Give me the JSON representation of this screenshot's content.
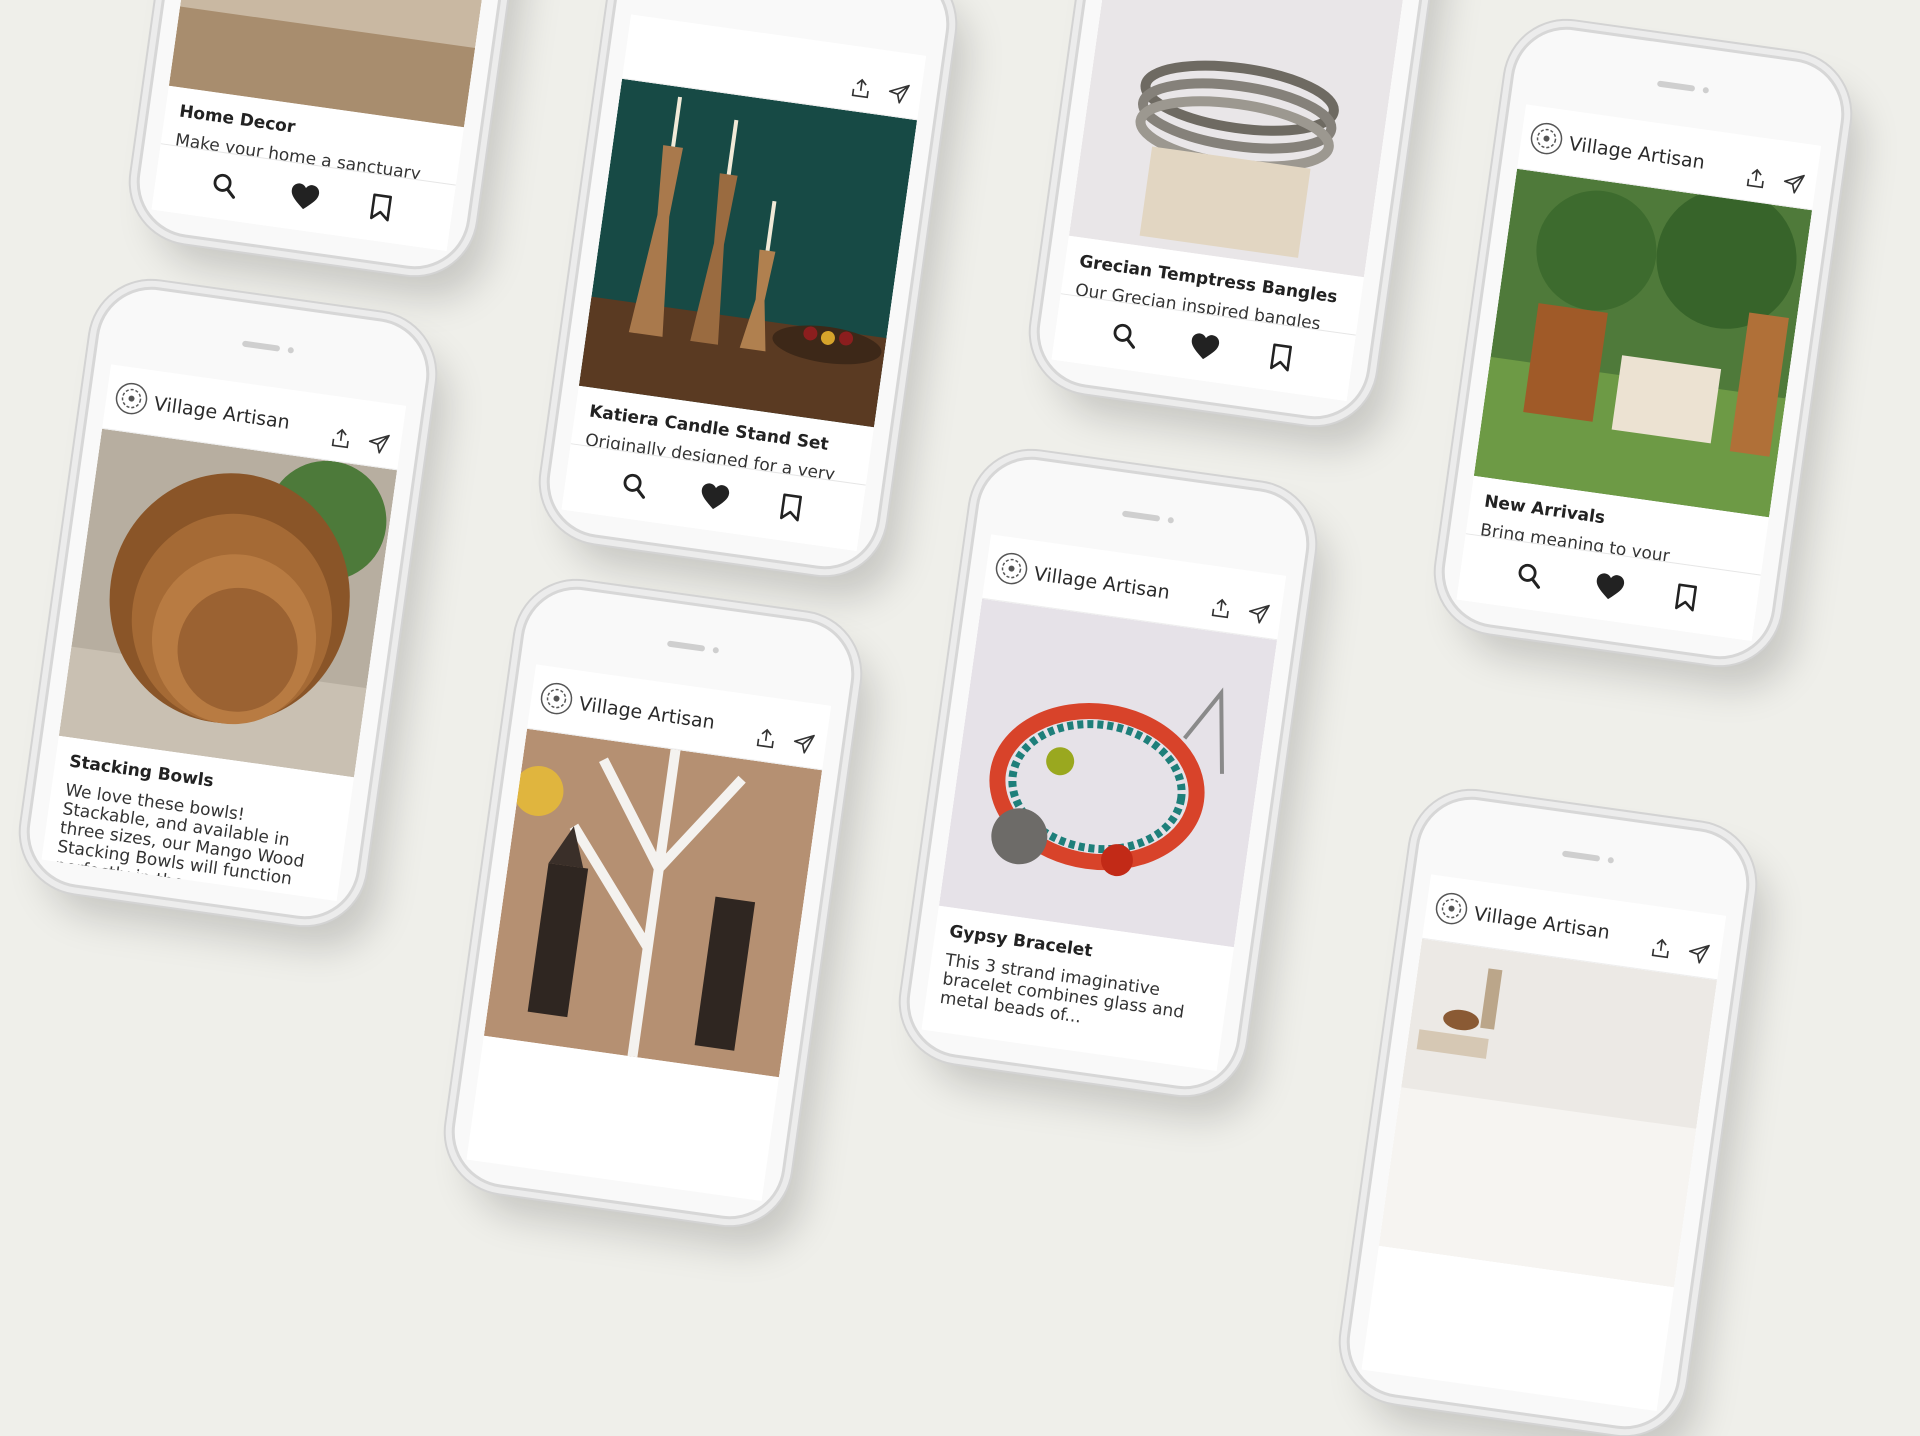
{
  "colors": {
    "background": "#efefea",
    "text": "#222222",
    "icon": "#222222"
  },
  "brand": {
    "name": "Village Artisan",
    "logo_icon": "mandala-logo-icon"
  },
  "header_icons": [
    "share-icon",
    "send-icon"
  ],
  "action_icons": [
    "search-icon",
    "heart-icon",
    "bookmark-icon"
  ],
  "posts": [
    {
      "title": "Home Decor",
      "description": "Make your home a sanctuary through quality, handcrafted decor with a story."
    },
    {
      "title": "Katiera Candle Stand Set",
      "description": "Originally designed for a very special wedding for our team, the wedding of VA founder.."
    },
    {
      "title": "Grecian Temptress Bangles",
      "description": "Our Grecian inspired bangles are an antiqued set of five gold tone bracelets featuring one center bold ..."
    },
    {
      "title": "New Arrivals",
      "description": "Bring meaning to your everyday routine through functional pieces that carry the craftsmanship and love..."
    },
    {
      "title": "Stacking Bowls",
      "description": "We love these bowls! Stackable, and available in three sizes, our Mango Wood Stacking Bowls will function perfectly in the...."
    },
    {
      "title": "",
      "description": ""
    },
    {
      "title": "Gypsy Bracelet",
      "description": "This 3 strand imaginative bracelet combines glass and metal beads of..."
    },
    {
      "title": "",
      "description": ""
    }
  ]
}
